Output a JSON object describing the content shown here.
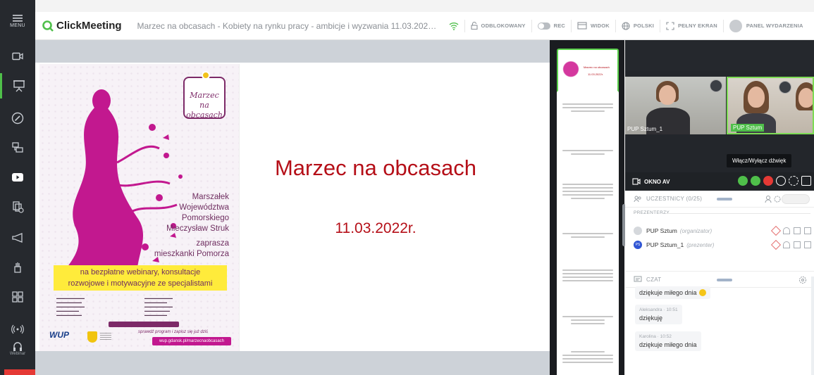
{
  "sidebar": {
    "menu_label": "MENU",
    "bottom_label": "Webinar"
  },
  "topbar": {
    "brand": "ClickMeeting",
    "title": "Marzec na obcasach - Kobiety na rynku pracy - ambicje i wyzwania 11.03.2022r. ...",
    "controls": {
      "unlocked": "ODBLOKOWANY",
      "rec": "REC",
      "view": "WIDOK",
      "language": "POLSKI",
      "fullscreen": "PEŁNY EKRAN",
      "event_panel": "PANEL WYDARZENIA"
    }
  },
  "slide": {
    "title": "Marzec na obcasach",
    "date": "11.03.2022r.",
    "poster": {
      "logo_text": "Marzec na obcasach",
      "right_text": [
        "Marszałek",
        "Województwa",
        "Pomorskiego",
        "Mieczysław Struk",
        "zaprasza",
        "mieszkanki Pomorza"
      ],
      "banner_line1": "na bezpłatne webinary, konsultacje",
      "banner_line2": "rozwojowe i motywacyjne ze specjalistami",
      "script_text": "sprawdź program i zapisz się już dziś",
      "url": "wup.gdansk.pl/marzecnaobcasach",
      "wup": "WUP"
    }
  },
  "thumbnails": {
    "first_label": "Marzec na obcasach",
    "first_sub": "11.03.2022r."
  },
  "video": {
    "tile1_name": "PUP Sztum_1",
    "tile2_name": "PUP Sztum",
    "tooltip": "Włącz/Wyłącz dźwięk"
  },
  "av_panel": {
    "label": "OKNO AV"
  },
  "participants": {
    "header": "UCZESTNICY (0/25)",
    "presenters_label": "PREZENTERZY",
    "rows": [
      {
        "name": "PUP Sztum",
        "role": "(organizator)",
        "initials": ""
      },
      {
        "name": "PUP Sztum_1",
        "role": "(prezenter)",
        "initials": "PS"
      }
    ]
  },
  "chat": {
    "header": "CZAT",
    "messages": [
      {
        "author": "",
        "time": "",
        "text": "dziękuje miłego dnia"
      },
      {
        "author": "Aleksandra",
        "time": "10:51",
        "text": "dziękuję"
      },
      {
        "author": "Karolina",
        "time": "10:52",
        "text": "dziękuje miłego dnia"
      }
    ]
  },
  "colors": {
    "accent_green": "#4fbf4a",
    "slide_red": "#b50f18",
    "poster_magenta": "#c2188f",
    "sidebar_dark": "#26292e"
  }
}
